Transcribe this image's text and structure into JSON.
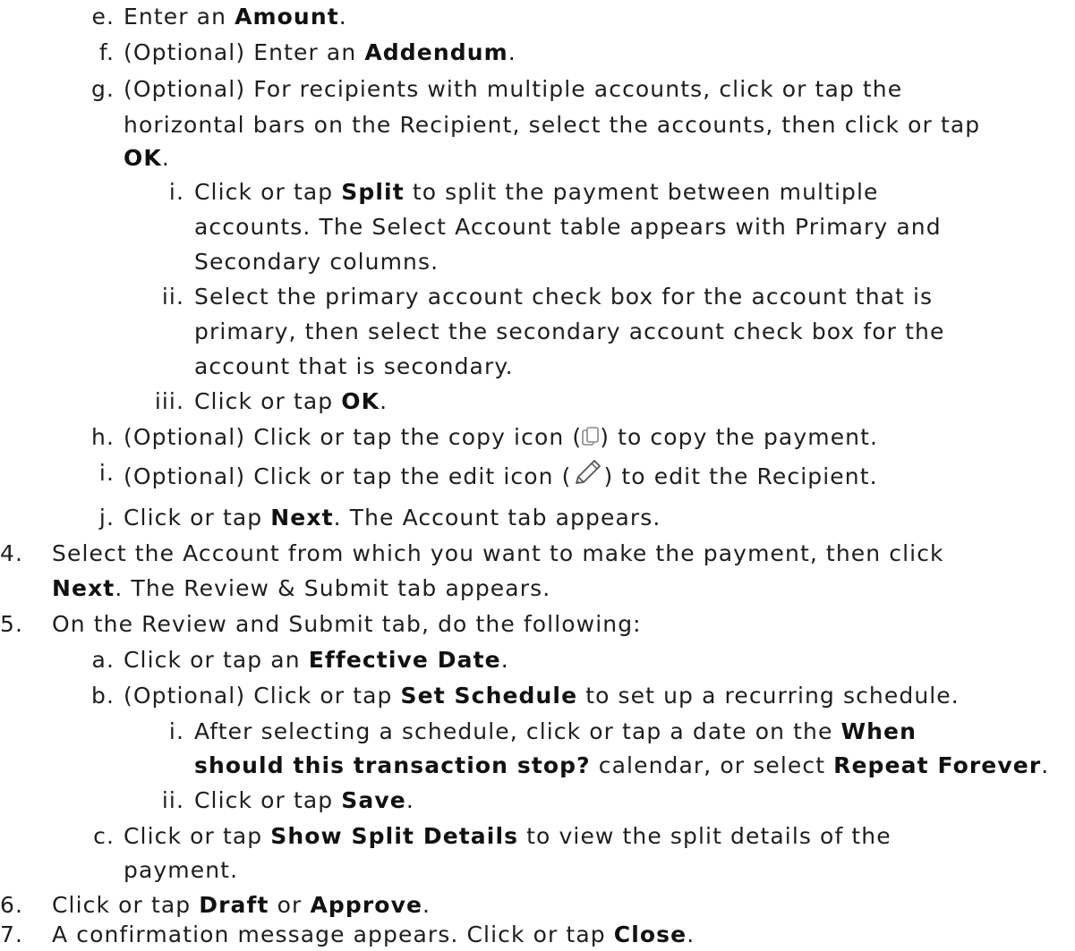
{
  "items": [
    {
      "marker": "e.",
      "parts": [
        "Enter an ",
        "Amount",
        "."
      ]
    },
    {
      "marker": "f.",
      "parts": [
        "(Optional) Enter an ",
        "Addendum",
        "."
      ]
    },
    {
      "marker": "g.",
      "parts": [
        "(Optional) For recipients with multiple accounts, click or tap the"
      ]
    },
    {
      "cont": "horizontal bars on the Recipient, select the accounts, then click or tap"
    },
    {
      "parts": [
        "OK",
        "."
      ]
    },
    {
      "marker": "i.",
      "parts": [
        "Click or tap ",
        "Split",
        " to split the payment between multiple"
      ]
    },
    {
      "cont": "accounts. The Select Account table appears with Primary and"
    },
    {
      "cont": "Secondary columns."
    },
    {
      "marker": "ii.",
      "parts": [
        "Select the primary account check box for the account that is"
      ]
    },
    {
      "cont": "primary, then select the secondary account check box for the"
    },
    {
      "cont": "account that is secondary."
    },
    {
      "marker": "iii.",
      "parts": [
        "Click or tap ",
        "OK",
        "."
      ]
    },
    {
      "marker": "h.",
      "parts": [
        "(Optional) Click or tap the copy icon (",
        ") to copy the payment."
      ]
    },
    {
      "marker": "i.",
      "parts": [
        "(Optional) Click or tap the edit icon (",
        ") to edit the Recipient."
      ]
    },
    {
      "marker": "j.",
      "parts": [
        "Click or tap ",
        "Next",
        ". The Account tab appears."
      ]
    },
    {
      "marker": "4.",
      "parts": [
        "Select the Account from which you want to make the payment, then click"
      ]
    },
    {
      "parts": [
        "Next",
        ". The Review & Submit tab appears."
      ]
    },
    {
      "marker": "5.",
      "parts": [
        "On the Review and Submit tab, do the following:"
      ]
    },
    {
      "marker": "a.",
      "parts": [
        "Click or tap an ",
        "Effective Date",
        "."
      ]
    },
    {
      "marker": "b.",
      "parts": [
        "(Optional) Click or tap ",
        "Set Schedule",
        " to set up a recurring schedule."
      ]
    },
    {
      "marker": "i.",
      "parts": [
        "After selecting a schedule, click or tap a date on the ",
        "When"
      ]
    },
    {
      "parts": [
        "should this transaction stop?",
        " calendar, or select ",
        "Repeat Forever",
        "."
      ]
    },
    {
      "marker": "ii.",
      "parts": [
        "Click or tap ",
        "Save",
        "."
      ]
    },
    {
      "marker": "c.",
      "parts": [
        "Click or tap ",
        "Show Split Details",
        " to view the split details of the"
      ]
    },
    {
      "cont": "payment."
    },
    {
      "marker": "6.",
      "parts": [
        "Click or tap ",
        "Draft",
        " or ",
        "Approve",
        "."
      ]
    },
    {
      "marker": "7.",
      "parts": [
        "A confirmation message appears. Click or tap ",
        "Close",
        "."
      ]
    }
  ],
  "icons": {
    "copy": "copy-icon",
    "edit": "edit-pencil-icon"
  }
}
